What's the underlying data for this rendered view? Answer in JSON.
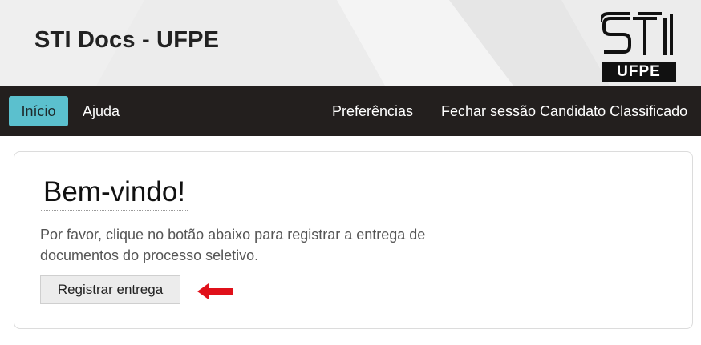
{
  "header": {
    "title": "STI Docs - UFPE",
    "logo": {
      "top_text": "STI",
      "bottom_text": "UFPE"
    }
  },
  "nav": {
    "left": [
      {
        "label": "Início",
        "active": true
      },
      {
        "label": "Ajuda",
        "active": false
      }
    ],
    "right": [
      {
        "label": "Preferências"
      },
      {
        "label": "Fechar sessão Candidato Classificado"
      }
    ]
  },
  "main": {
    "heading": "Bem-vindo!",
    "instructions_line1": "Por favor, clique no botão abaixo para registrar a entrega de",
    "instructions_line2": "documentos do processo seletivo.",
    "register_button": "Registrar entrega"
  },
  "colors": {
    "navbar_bg": "#231f1e",
    "active_nav_bg": "#5bc0ce",
    "annotation_arrow": "#e0101a"
  },
  "icons": {
    "annotation": "red-arrow-left-icon"
  }
}
